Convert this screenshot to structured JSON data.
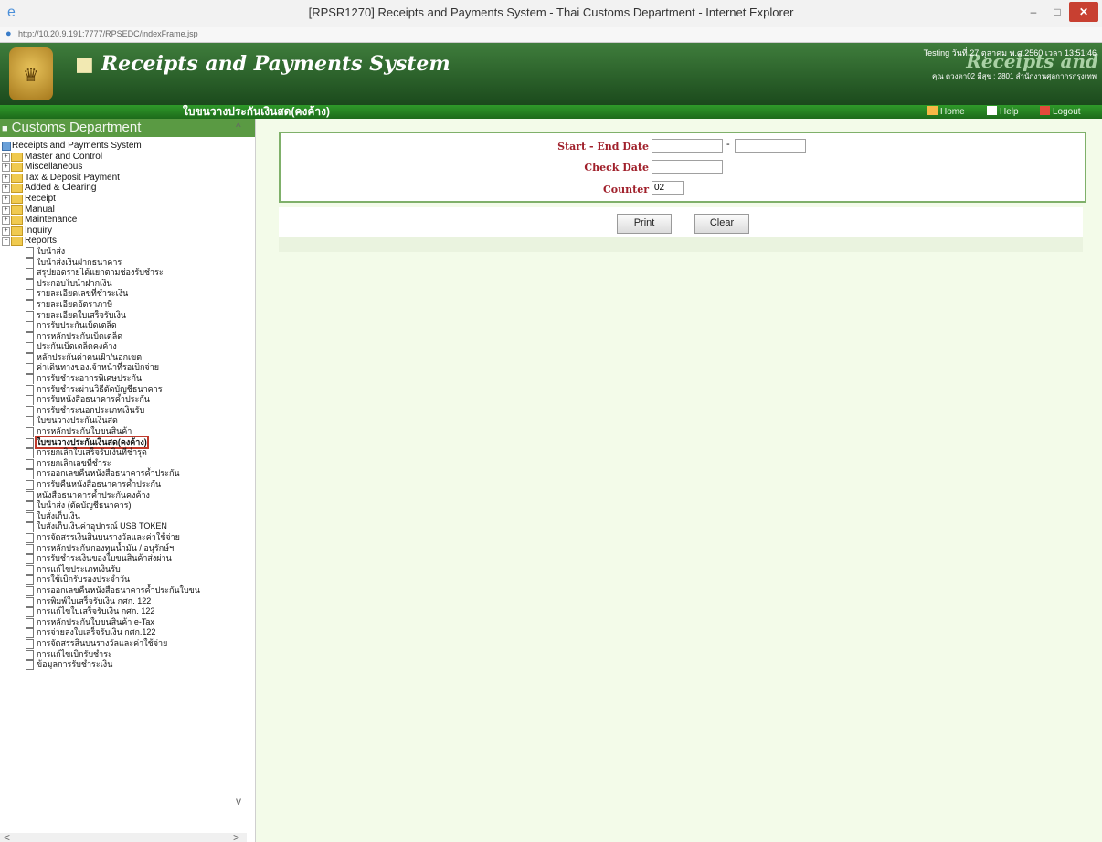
{
  "window": {
    "title": "[RPSR1270] Receipts and Payments System - Thai Customs Department - Internet Explorer",
    "url": "http://10.20.9.191:7777/RPSEDC/indexFrame.jsp",
    "min_label": "–",
    "max_label": "□",
    "close_label": "✕"
  },
  "header": {
    "logo_glyph": "♛",
    "hash": "■",
    "app_name": "Receipts and Payments System",
    "user_line1": "Testing วันที่ 27 ตุลาคม พ.ศ.2560 เวลา 13:51:46",
    "user_line2": "คุณ ดวงตา02 มีสุข : 2801 สำนักงานศุลกากรกรุงเทพ",
    "brand_faded": "Receipts and"
  },
  "titlebar": {
    "page_title": "ใบขนวางประกันเงินสด(คงค้าง)",
    "home": "Home",
    "help": "Help",
    "logout": "Logout"
  },
  "sidebar": {
    "header": "Customs Department",
    "header_bullet": "■",
    "root": "Receipts and Payments System",
    "folders": [
      "Master and Control",
      "Miscellaneous",
      "Tax & Deposit Payment",
      "Added & Clearing",
      "Receipt",
      "Manual",
      "Maintenance",
      "Inquiry",
      "Reports"
    ],
    "reports": [
      "ใบนำส่ง",
      "ใบนำส่งเงินฝากธนาคาร",
      "สรุปยอดรายได้แยกตามช่องรับชำระ",
      "ประกอบใบนำฝากเงิน",
      "รายละเอียดเลขที่ชำระเงิน",
      "รายละเอียดอัตราภาษี",
      "รายละเอียดใบเสร็จรับเงิน",
      "การรับประกันเบ็ดเตล็ด",
      "การหลักประกันเบ็ดเตล็ด",
      "ประกันเบ็ดเตล็ดคงค้าง",
      "หลักประกันค่าคนเฝ้า/นอกเขต",
      "ค่าเดินทางของเจ้าหน้าที่รอเบิกจ่าย",
      "การรับชำระอากรพิเศษประกัน",
      "การรับชำระผ่านวิธีตัดบัญชีธนาคาร",
      "การรับหนังสือธนาคารค้ำประกัน",
      "การรับชำระนอกประเภทเงินรับ",
      "ใบขนวางประกันเงินสด",
      "การหลักประกันใบขนสินค้า",
      "ใบขนวางประกันเงินสด(คงค้าง)",
      "การยกเลิกใบเสร็จรับเงินที่ชำรุด",
      "การยกเลิกเลขที่ชำระ",
      "การออกเลขคืนหนังสือธนาคารค้ำประกัน",
      "การรับคืนหนังสือธนาคารค้ำประกัน",
      "หนังสือธนาคารค้ำประกันคงค้าง",
      "ใบนำส่ง (ตัดบัญชีธนาคาร)",
      "ใบสั่งเก็บเงิน",
      "ใบสั่งเก็บเงินค่าอุปกรณ์ USB TOKEN",
      "การจัดสรรเงินสินบนรางวัลและค่าใช้จ่าย",
      "การหลักประกันกองทุนน้ำมัน / อนุรักษ์ฯ",
      "การรับชำระเงินของใบขนสินค้าส่งผ่าน",
      "การแก้ไขประเภทเงินรับ",
      "การใช้เบิกรับรองประจำวัน",
      "การออกเลขคืนหนังสือธนาคารค้ำประกันใบขน",
      "การพิมพ์ใบเสร็จรับเงิน กศก. 122",
      "การแก้ไขใบเสร็จรับเงิน กศก. 122",
      "การหลักประกันใบขนสินค้า e-Tax",
      "การจ่ายลงใบเสร็จรับเงิน กศก.122",
      "การจัดสรรสินบนรางวัลและค่าใช้จ่าย",
      "การแก้ไขเบิกรับชำระ",
      "ข้อมูลการรับชำระเงิน"
    ],
    "selected_index": 18,
    "scroll_up": "^",
    "scroll_down": "v",
    "hscroll_left": "<",
    "hscroll_right": ">"
  },
  "form": {
    "date_label": "Start - End Date",
    "start_value": "",
    "dash": "-",
    "end_value": "",
    "check_label": "Check Date",
    "check_value": "",
    "counter_label": "Counter",
    "counter_value": "02",
    "print_label": "Print",
    "clear_label": "Clear"
  },
  "colors": {
    "header_green": "#2a6b29",
    "accent_red": "#a0202b",
    "panel_bg": "#f3fbe9"
  }
}
